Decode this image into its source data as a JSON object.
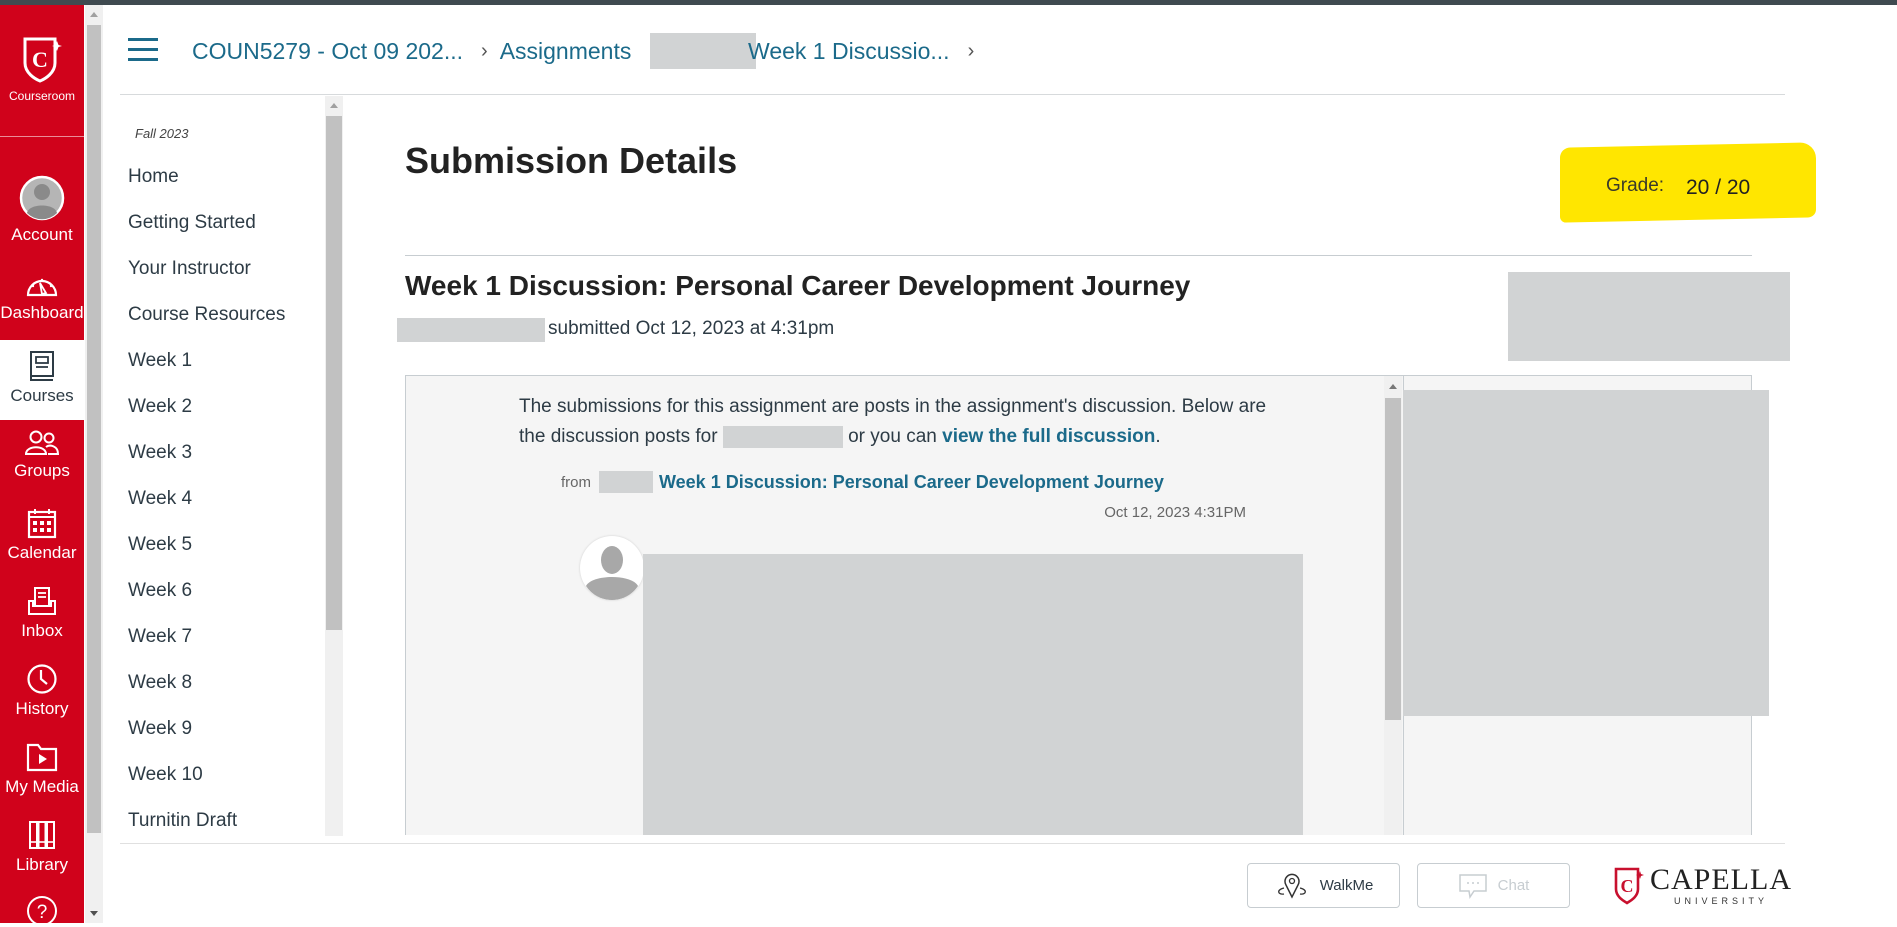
{
  "global_nav": {
    "brand_label": "Courseroom",
    "items": [
      {
        "label": "Account",
        "icon": "account-avatar-icon"
      },
      {
        "label": "Dashboard",
        "icon": "dashboard-gauge-icon"
      },
      {
        "label": "Courses",
        "icon": "courses-book-icon",
        "active": true
      },
      {
        "label": "Groups",
        "icon": "groups-people-icon"
      },
      {
        "label": "Calendar",
        "icon": "calendar-icon"
      },
      {
        "label": "Inbox",
        "icon": "inbox-tray-icon"
      },
      {
        "label": "History",
        "icon": "history-clock-icon"
      },
      {
        "label": "My Media",
        "icon": "media-folder-play-icon"
      },
      {
        "label": "Library",
        "icon": "library-books-icon"
      },
      {
        "label": "",
        "icon": "help-question-icon"
      }
    ],
    "accent_color": "#d0021b"
  },
  "breadcrumb": {
    "items": [
      "COUN5279 - Oct 09 202...",
      "Assignments",
      "Week 1 Discussio..."
    ],
    "link_color": "#1b6a8a"
  },
  "course_nav": {
    "term": "Fall 2023",
    "items": [
      "Home",
      "Getting Started",
      "Your Instructor",
      "Course Resources",
      "Week 1",
      "Week 2",
      "Week 3",
      "Week 4",
      "Week 5",
      "Week 6",
      "Week 7",
      "Week 8",
      "Week 9",
      "Week 10",
      "Turnitin Draft"
    ]
  },
  "main": {
    "title": "Submission Details",
    "grade_label": "Grade:",
    "grade_value": "20 / 20",
    "highlight_color": "#ffe600",
    "assignment_title": "Week 1 Discussion: Personal Career Development Journey",
    "submitted_text": "submitted Oct 12, 2023 at 4:31pm",
    "intro_part1": "The submissions for this assignment are posts in the assignment's discussion. Below are the discussion posts for",
    "intro_part2": "or you can",
    "intro_link": "view the full discussion",
    "intro_end": ".",
    "from_label": "from",
    "post_link": "Week 1 Discussion: Personal Career Development Journey",
    "post_date": "Oct 12, 2023 4:31PM"
  },
  "footer": {
    "walkme_label": "WalkMe",
    "chat_label": "Chat",
    "logo_name": "CAPELLA",
    "logo_sub": "UNIVERSITY"
  }
}
